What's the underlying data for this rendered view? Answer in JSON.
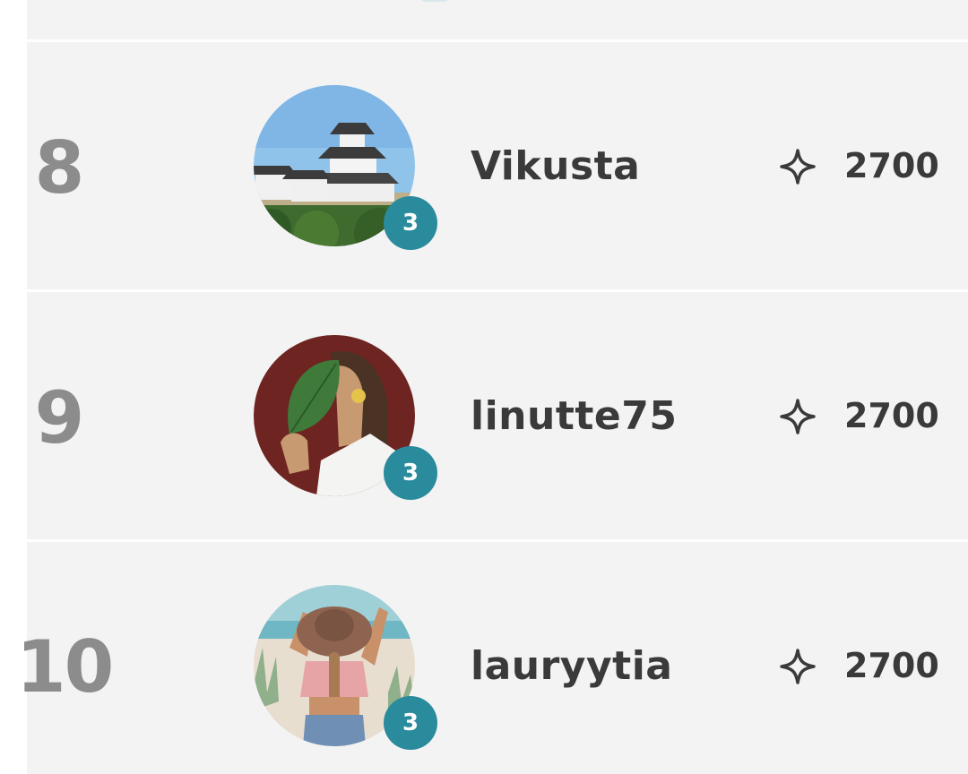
{
  "leaderboard": {
    "entries": [
      {
        "rank": "8",
        "username": "Vikusta",
        "level": "3",
        "points": "2700",
        "avatar_icon": "castle-avatar"
      },
      {
        "rank": "9",
        "username": "linutte75",
        "level": "3",
        "points": "2700",
        "avatar_icon": "woman-leaf-avatar"
      },
      {
        "rank": "10",
        "username": "lauryytia",
        "level": "3",
        "points": "2700",
        "avatar_icon": "beach-woman-avatar"
      }
    ],
    "points_icon": "sparkle-icon",
    "colors": {
      "row_background": "#f3f3f3",
      "rank_text": "#8c8c8c",
      "name_text": "#3a3a3a",
      "level_badge": "#2a8b9c"
    }
  }
}
